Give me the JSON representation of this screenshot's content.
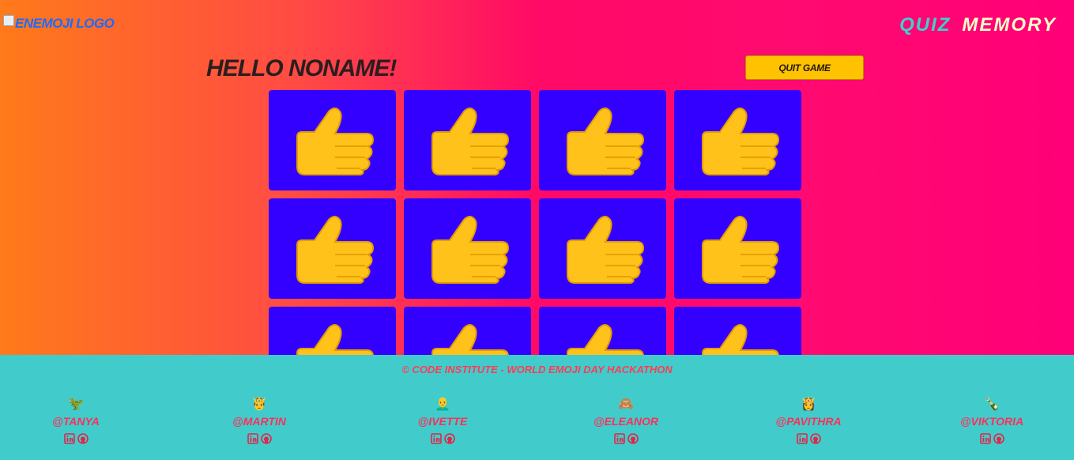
{
  "header": {
    "logo_alt": "enemoji logo",
    "nav": {
      "quiz": "QUIZ",
      "memory": "MEMORY"
    }
  },
  "game": {
    "greeting": "HELLO NONAME!",
    "quit_label": "QUIT GAME",
    "card_back_icon": "thumbs-up-icon"
  },
  "footer": {
    "copyright": "© Code Institute - World Emoji Day Hackathon",
    "members": [
      {
        "emoji": "🦖",
        "handle": "@TANYA"
      },
      {
        "emoji": "🤴",
        "handle": "@MARTIN"
      },
      {
        "emoji": "👨‍🦲",
        "handle": "@IVETTE"
      },
      {
        "emoji": "🙈",
        "handle": "@ELEANOR"
      },
      {
        "emoji": "👸",
        "handle": "@PAVITHRA"
      },
      {
        "emoji": "🍾",
        "handle": "@VIKTORIA"
      }
    ]
  },
  "colors": {
    "card": "#3300ff",
    "footer": "#41cccb",
    "quit": "#ffc200",
    "accent": "#ff2f5a"
  }
}
